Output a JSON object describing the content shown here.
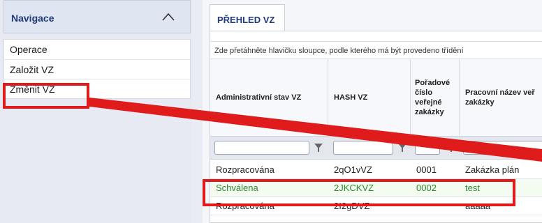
{
  "sidebar": {
    "title": "Navigace",
    "items": [
      {
        "label": "Operace"
      },
      {
        "label": "Založit VZ"
      },
      {
        "label": "Změnit VZ"
      }
    ]
  },
  "main": {
    "tab_label": "PŘEHLED VZ",
    "group_hint": "Zde přetáhněte hlavičku sloupce, podle kterého má být provedeno třídění",
    "columns": [
      {
        "header": "Administrativní stav VZ"
      },
      {
        "header": "HASH VZ"
      },
      {
        "header": "Pořadové číslo veřejné zakázky"
      },
      {
        "header": "Pracovní název veř zakázky"
      }
    ],
    "rows": [
      {
        "stav": "Rozpracována",
        "hash": "2qO1vVZ",
        "cislo": "0001",
        "nazev": "Zakázka plán"
      },
      {
        "stav": "Schválena",
        "hash": "2JKCKVZ",
        "cislo": "0002",
        "nazev": "test"
      },
      {
        "stav": "Rozpracována",
        "hash": "2I2gDVZ",
        "cislo": "",
        "nazev": "aaaaa"
      }
    ]
  },
  "colors": {
    "accent": "#1e3a7a",
    "highlight_row": "#2e8a2e",
    "annotation": "#e01b1b"
  }
}
